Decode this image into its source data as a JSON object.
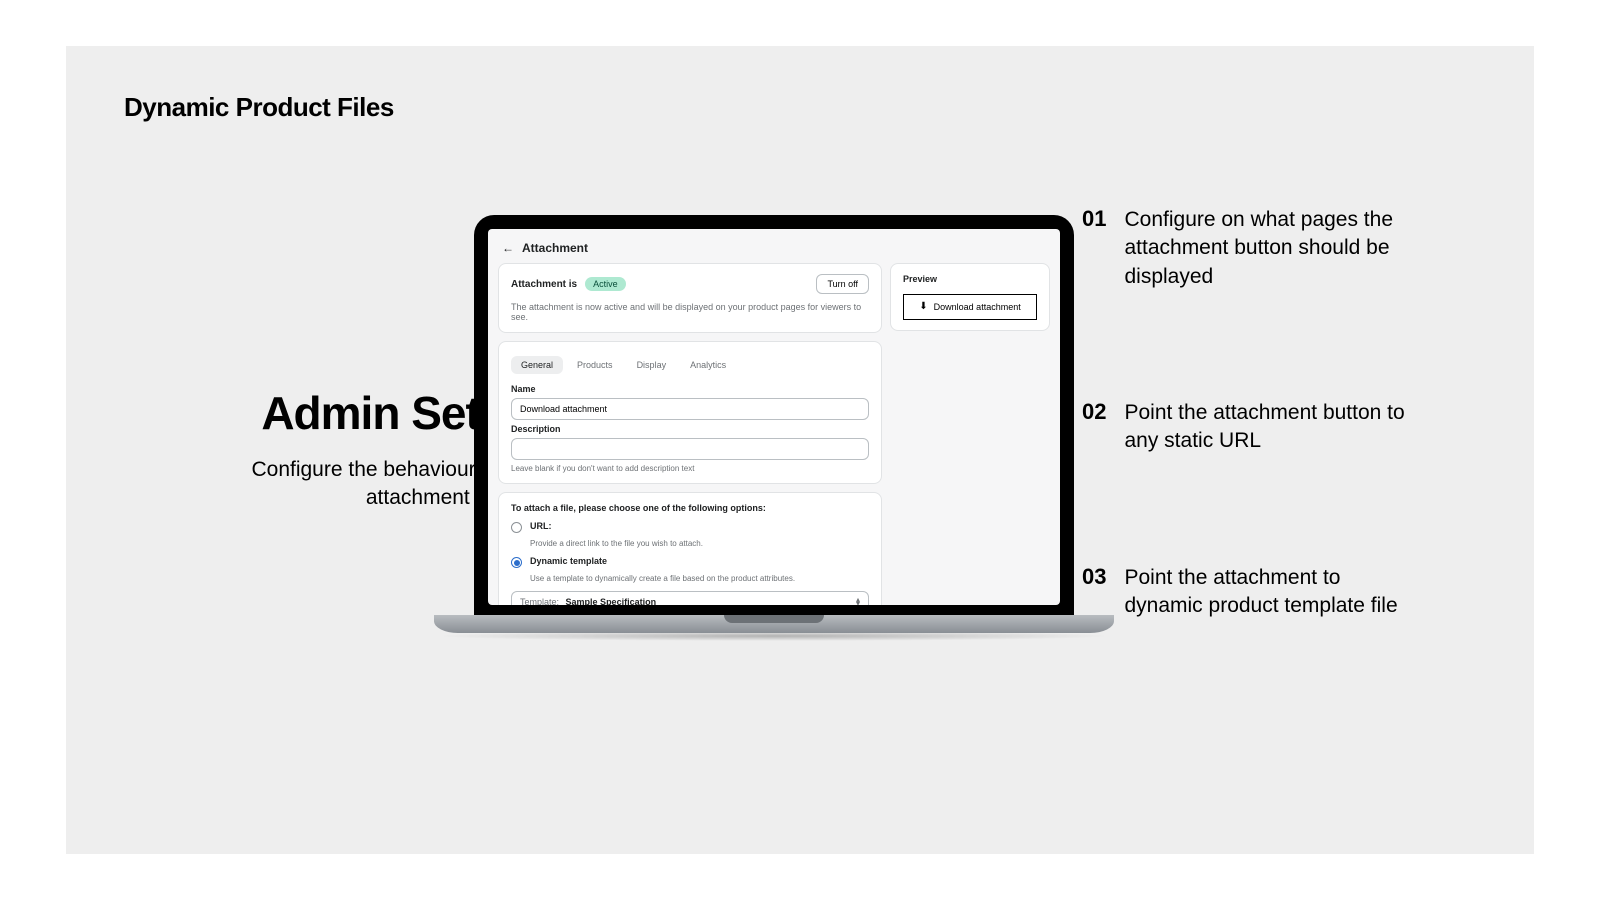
{
  "brand": "Dynamic Product Files",
  "left": {
    "title": "Admin Setup",
    "subtitle": "Configure the behaviour of the attachment button"
  },
  "steps": [
    {
      "num": "01",
      "text": "Configure on what pages the attachment button should be displayed"
    },
    {
      "num": "02",
      "text": "Point the attachment button to any static URL"
    },
    {
      "num": "03",
      "text": "Point the attachment to dynamic product template file"
    }
  ],
  "admin": {
    "back_icon": "←",
    "page_title": "Attachment",
    "status": {
      "label": "Attachment is",
      "badge": "Active",
      "description": "The attachment is now active and will be displayed on your product pages for viewers to see.",
      "turn_off": "Turn off"
    },
    "tabs": {
      "general": "General",
      "products": "Products",
      "display": "Display",
      "analytics": "Analytics"
    },
    "fields": {
      "name_label": "Name",
      "name_value": "Download attachment",
      "description_label": "Description",
      "description_value": "",
      "description_hint": "Leave blank if you don't want to add description text"
    },
    "attach": {
      "intro": "To attach a file, please choose one of the following options:",
      "url_label": "URL:",
      "url_desc": "Provide a direct link to the file you wish to attach.",
      "dynamic_label": "Dynamic template",
      "dynamic_desc": "Use a template to dynamically create a file based on the product attributes.",
      "template_label": "Template:",
      "template_value": "Sample Specification"
    },
    "preview": {
      "label": "Preview",
      "button": "Download attachment"
    }
  }
}
